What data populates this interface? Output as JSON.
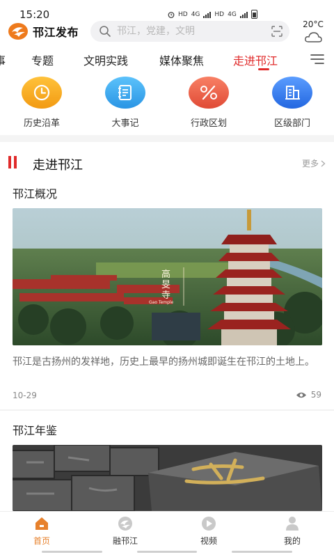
{
  "status_bar": {
    "time": "15:20",
    "net_labels": [
      "HD",
      "4G",
      "HD",
      "4G"
    ]
  },
  "header": {
    "app_name": "邗江发布",
    "search_placeholder": "邗江，党建，文明",
    "weather_temp": "20°C",
    "weather_icon": "cloudy-icon"
  },
  "tabs": [
    {
      "label": "事",
      "active": false
    },
    {
      "label": "专题",
      "active": false
    },
    {
      "label": "文明实践",
      "active": false
    },
    {
      "label": "媒体聚焦",
      "active": false
    },
    {
      "label": "走进邗江",
      "active": true
    }
  ],
  "quick_entries": [
    {
      "label": "历史沿革",
      "icon": "clock-icon",
      "color": "#f5a623"
    },
    {
      "label": "大事记",
      "icon": "notebook-icon",
      "color": "#2fa0ea"
    },
    {
      "label": "行政区划",
      "icon": "percent-icon",
      "color": "#ea5a43"
    },
    {
      "label": "区级部门",
      "icon": "building-icon",
      "color": "#2e7df0"
    }
  ],
  "section": {
    "title": "走进邗江",
    "more": "更多"
  },
  "articles": [
    {
      "title": "邗江概况",
      "image_caption_cn": "高旻寺",
      "image_caption_en": "Gao Temple",
      "description": "邗江是古扬州的发祥地，历史上最早的扬州城即诞生在邗江的土地上。",
      "date": "10-29",
      "views": "59"
    },
    {
      "title": "邗江年鉴"
    }
  ],
  "bottom_nav": [
    {
      "label": "首页",
      "icon": "home-icon",
      "active": true
    },
    {
      "label": "融邗江",
      "icon": "fusion-icon",
      "active": false
    },
    {
      "label": "视频",
      "icon": "play-icon",
      "active": false
    },
    {
      "label": "我的",
      "icon": "user-icon",
      "active": false
    }
  ],
  "colors": {
    "accent_red": "#e02a2a",
    "nav_active": "#e7812c"
  }
}
